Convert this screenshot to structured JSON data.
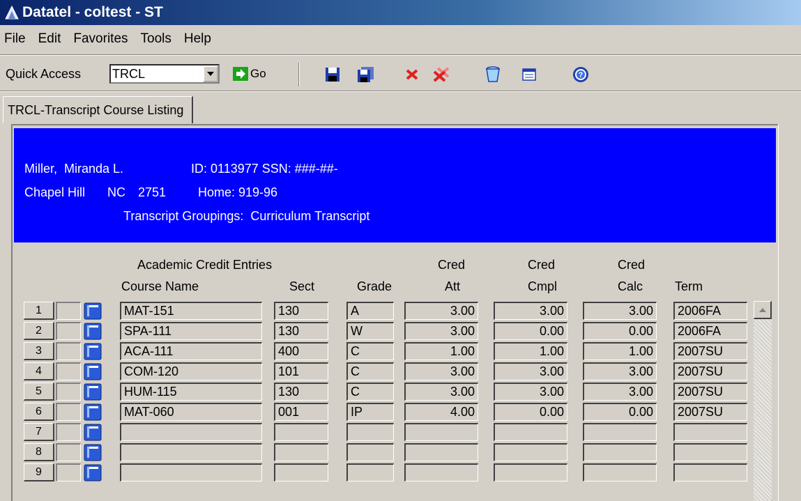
{
  "window": {
    "title": "Datatel - coltest - ST"
  },
  "menu": [
    "File",
    "Edit",
    "Favorites",
    "Tools",
    "Help"
  ],
  "toolbar": {
    "quick_access_label": "Quick Access",
    "quick_access_value": "TRCL",
    "go_label": "Go"
  },
  "tab": {
    "label": "TRCL-Transcript Course Listing"
  },
  "student": {
    "name": "Miller,  Miranda L.",
    "id_ssn": "ID: 0113977 SSN: ###-##-",
    "city": "Chapel Hill",
    "state": "NC",
    "zip": "2751",
    "home": "Home: 919-96",
    "groupings": "Transcript Groupings:  Curriculum Transcript"
  },
  "columns": {
    "section_title": "Academic Credit Entries",
    "course": "Course Name",
    "sect": "Sect",
    "grade": "Grade",
    "att_top": "Cred",
    "att_bottom": "Att",
    "cmpl_top": "Cred",
    "cmpl_bottom": "Cmpl",
    "calc_top": "Cred",
    "calc_bottom": "Calc",
    "term": "Term"
  },
  "rows": [
    {
      "num": "1",
      "course": "MAT-151",
      "sect": "130",
      "grade": "A",
      "att": "3.00",
      "cmpl": "3.00",
      "calc": "3.00",
      "term": "2006FA"
    },
    {
      "num": "2",
      "course": "SPA-111",
      "sect": "130",
      "grade": "W",
      "att": "3.00",
      "cmpl": "0.00",
      "calc": "0.00",
      "term": "2006FA"
    },
    {
      "num": "3",
      "course": "ACA-111",
      "sect": "400",
      "grade": "C",
      "att": "1.00",
      "cmpl": "1.00",
      "calc": "1.00",
      "term": "2007SU"
    },
    {
      "num": "4",
      "course": "COM-120",
      "sect": "101",
      "grade": "C",
      "att": "3.00",
      "cmpl": "3.00",
      "calc": "3.00",
      "term": "2007SU"
    },
    {
      "num": "5",
      "course": "HUM-115",
      "sect": "130",
      "grade": "C",
      "att": "3.00",
      "cmpl": "3.00",
      "calc": "3.00",
      "term": "2007SU"
    },
    {
      "num": "6",
      "course": "MAT-060",
      "sect": "001",
      "grade": "IP",
      "att": "4.00",
      "cmpl": "0.00",
      "calc": "0.00",
      "term": "2007SU"
    },
    {
      "num": "7",
      "course": "",
      "sect": "",
      "grade": "",
      "att": "",
      "cmpl": "",
      "calc": "",
      "term": ""
    },
    {
      "num": "8",
      "course": "",
      "sect": "",
      "grade": "",
      "att": "",
      "cmpl": "",
      "calc": "",
      "term": ""
    },
    {
      "num": "9",
      "course": "",
      "sect": "",
      "grade": "",
      "att": "",
      "cmpl": "",
      "calc": "",
      "term": ""
    }
  ],
  "colors": {
    "header_bg": "#0000ff",
    "window_bg": "#d4d0c8",
    "title_bar": "#0a246a"
  },
  "icons": [
    "app-icon",
    "dropdown-arrow-icon",
    "go-arrow-icon",
    "save-icon",
    "save-all-icon",
    "cancel-icon",
    "cancel-all-icon",
    "trash-icon",
    "form-icon",
    "help-icon",
    "detail-icon",
    "scroll-up-icon"
  ]
}
